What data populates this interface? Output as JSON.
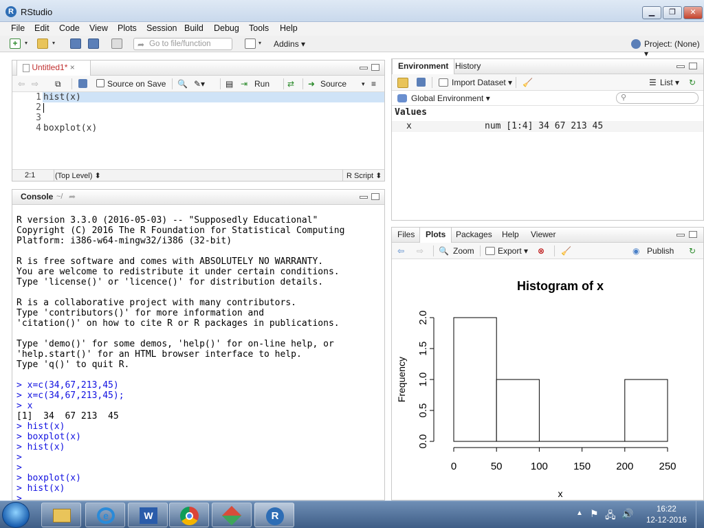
{
  "window": {
    "title": "RStudio"
  },
  "menu": [
    "File",
    "Edit",
    "Code",
    "View",
    "Plots",
    "Session",
    "Build",
    "Debug",
    "Tools",
    "Help"
  ],
  "toolbar": {
    "goto_placeholder": "Go to file/function",
    "addins": "Addins",
    "project": "Project: (None)"
  },
  "editor": {
    "tab": "Untitled1*",
    "source_on_save": "Source on Save",
    "run": "Run",
    "source": "Source",
    "lines": [
      {
        "num": "1",
        "text": "hist(x)"
      },
      {
        "num": "2",
        "text": ""
      },
      {
        "num": "3",
        "text": ""
      },
      {
        "num": "4",
        "text": "boxplot(x)"
      }
    ],
    "status_pos": "2:1",
    "status_level": "(Top Level)",
    "status_type": "R Script"
  },
  "console": {
    "title": "Console",
    "path": "~/",
    "lines": [
      {
        "t": "R version 3.3.0 (2016-05-03) -- \"Supposedly Educational\"",
        "c": ""
      },
      {
        "t": "Copyright (C) 2016 The R Foundation for Statistical Computing",
        "c": ""
      },
      {
        "t": "Platform: i386-w64-mingw32/i386 (32-bit)",
        "c": ""
      },
      {
        "t": "",
        "c": ""
      },
      {
        "t": "R is free software and comes with ABSOLUTELY NO WARRANTY.",
        "c": ""
      },
      {
        "t": "You are welcome to redistribute it under certain conditions.",
        "c": ""
      },
      {
        "t": "Type 'license()' or 'licence()' for distribution details.",
        "c": ""
      },
      {
        "t": "",
        "c": ""
      },
      {
        "t": "R is a collaborative project with many contributors.",
        "c": ""
      },
      {
        "t": "Type 'contributors()' for more information and",
        "c": ""
      },
      {
        "t": "'citation()' on how to cite R or R packages in publications.",
        "c": ""
      },
      {
        "t": "",
        "c": ""
      },
      {
        "t": "Type 'demo()' for some demos, 'help()' for on-line help, or",
        "c": ""
      },
      {
        "t": "'help.start()' for an HTML browser interface to help.",
        "c": ""
      },
      {
        "t": "Type 'q()' to quit R.",
        "c": ""
      },
      {
        "t": "",
        "c": ""
      },
      {
        "t": "> x=c(34,67,213,45)",
        "c": "blue"
      },
      {
        "t": "> x=c(34,67,213,45);",
        "c": "blue"
      },
      {
        "t": "> x",
        "c": "blue"
      },
      {
        "t": "[1]  34  67 213  45",
        "c": ""
      },
      {
        "t": "> hist(x)",
        "c": "blue"
      },
      {
        "t": "> boxplot(x)",
        "c": "blue"
      },
      {
        "t": "> hist(x)",
        "c": "blue"
      },
      {
        "t": ">",
        "c": "blue"
      },
      {
        "t": ">",
        "c": "blue"
      },
      {
        "t": "> boxplot(x)",
        "c": "blue"
      },
      {
        "t": "> hist(x)",
        "c": "blue"
      },
      {
        "t": ">",
        "c": "blue"
      }
    ]
  },
  "env": {
    "tabs": [
      "Environment",
      "History"
    ],
    "import": "Import Dataset",
    "list": "List",
    "scope": "Global Environment",
    "section": "Values",
    "var_name": "x",
    "var_value": "num [1:4] 34 67 213 45"
  },
  "files": {
    "tabs": [
      "Files",
      "Plots",
      "Packages",
      "Help",
      "Viewer"
    ],
    "zoom": "Zoom",
    "export": "Export",
    "publish": "Publish"
  },
  "chart_data": {
    "type": "bar",
    "title": "Histogram of x",
    "xlabel": "x",
    "ylabel": "Frequency",
    "bins": [
      [
        0,
        50
      ],
      [
        50,
        100
      ],
      [
        100,
        150
      ],
      [
        150,
        200
      ],
      [
        200,
        250
      ]
    ],
    "values": [
      2,
      1,
      0,
      0,
      1
    ],
    "xlim": [
      0,
      250
    ],
    "ylim": [
      0,
      2
    ],
    "xticks": [
      "0",
      "50",
      "100",
      "150",
      "200",
      "250"
    ],
    "yticks": [
      "0.0",
      "0.5",
      "1.0",
      "1.5",
      "2.0"
    ]
  },
  "taskbar": {
    "time": "16:22",
    "date": "12-12-2016"
  },
  "colors": {
    "accent": "#2d6db5",
    "prompt": "#1010e0",
    "highlight": "#cfe3f7"
  }
}
